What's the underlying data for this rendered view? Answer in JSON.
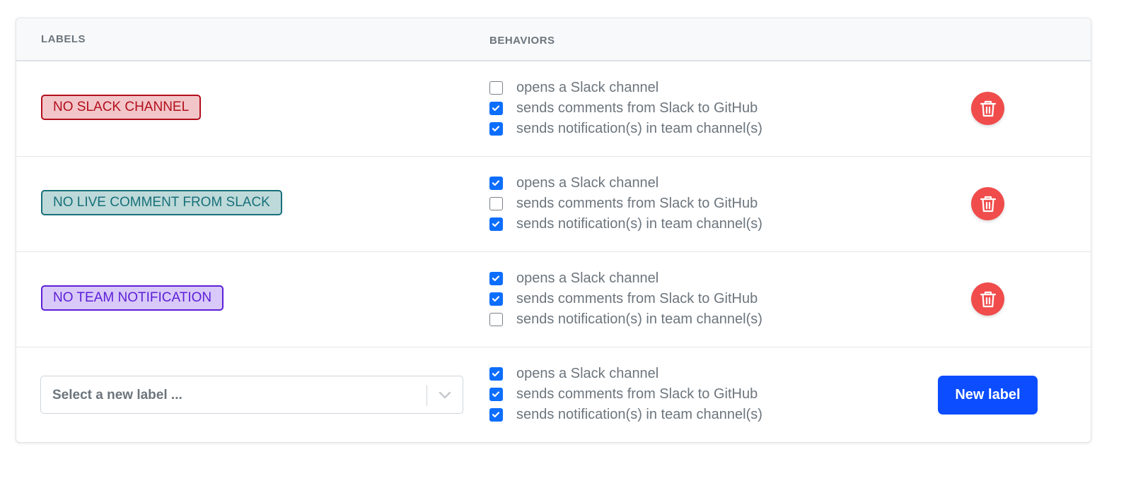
{
  "header": {
    "labels_col": "LABELS",
    "behaviors_col": "BEHAVIORS"
  },
  "behavior_names": {
    "open_channel": "opens a Slack channel",
    "sync_comments": "sends comments from Slack to GitHub",
    "notify_team": "sends notification(s) in team channel(s)"
  },
  "rows": [
    {
      "label": "NO SLACK CHANNEL",
      "colors": {
        "bg": "#f2c6c9",
        "border": "#b30e1c",
        "text": "#b30e1c"
      },
      "behaviors": [
        false,
        true,
        true
      ]
    },
    {
      "label": "NO LIVE COMMENT FROM SLACK",
      "colors": {
        "bg": "#bed9d9",
        "border": "#17707a",
        "text": "#17707a"
      },
      "behaviors": [
        true,
        false,
        true
      ]
    },
    {
      "label": "NO TEAM NOTIFICATION",
      "colors": {
        "bg": "#d9c9f8",
        "border": "#5b1fd6",
        "text": "#5b1fd6"
      },
      "behaviors": [
        true,
        true,
        false
      ]
    }
  ],
  "new_row": {
    "select_placeholder": "Select a new label ...",
    "behaviors": [
      true,
      true,
      true
    ],
    "button_label": "New label"
  },
  "icons": {
    "delete": "trash-icon",
    "checkbox_check": "check-icon",
    "dropdown": "chevron-down-icon"
  },
  "colors": {
    "accent": "#0d6efd",
    "new_button": "#0b4dff",
    "delete_button": "#f04c4c"
  }
}
